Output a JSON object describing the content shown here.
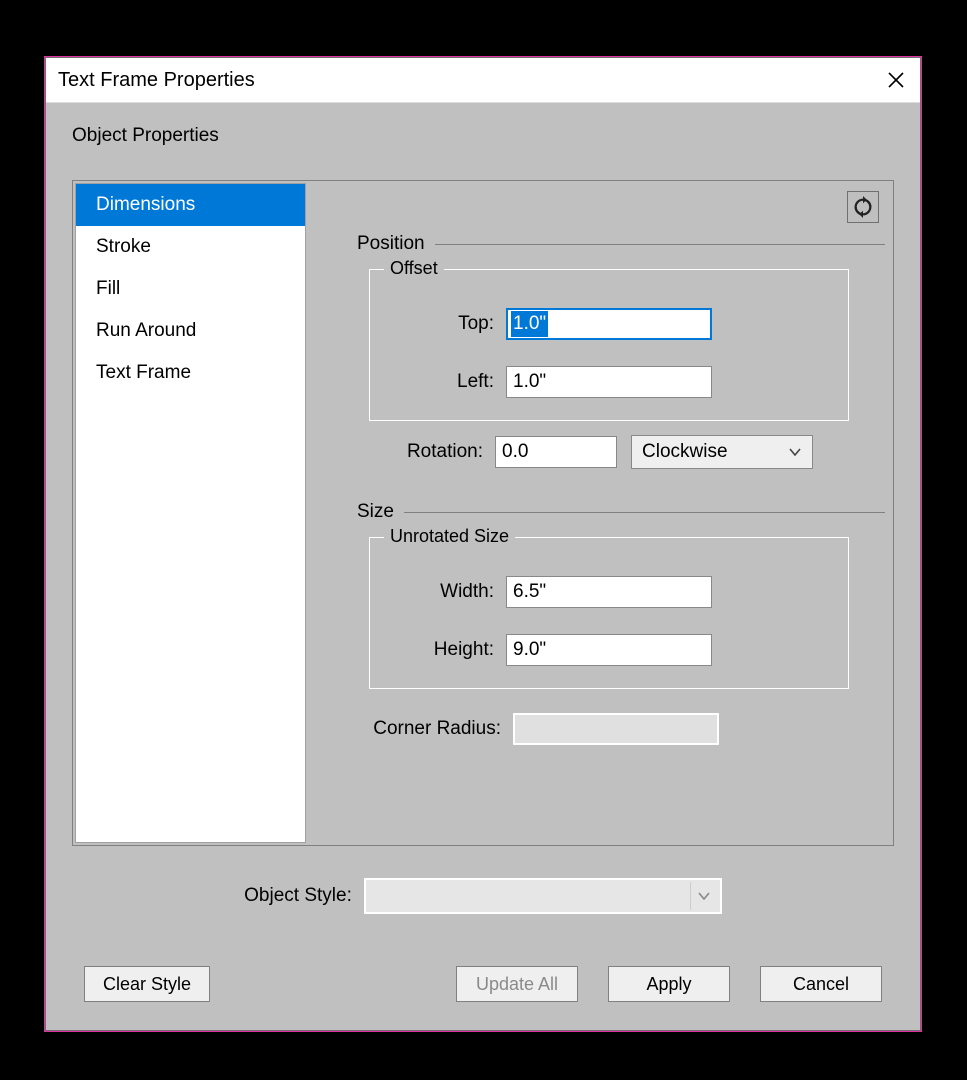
{
  "dialog": {
    "title": "Text Frame Properties",
    "subtitle": "Object Properties"
  },
  "sidebar": {
    "items": [
      {
        "label": "Dimensions",
        "selected": true
      },
      {
        "label": "Stroke",
        "selected": false
      },
      {
        "label": "Fill",
        "selected": false
      },
      {
        "label": "Run Around",
        "selected": false
      },
      {
        "label": "Text Frame",
        "selected": false
      }
    ]
  },
  "position": {
    "section_label": "Position",
    "offset_legend": "Offset",
    "top_label": "Top:",
    "top_value": "1.0\"",
    "left_label": "Left:",
    "left_value": "1.0\"",
    "rotation_label": "Rotation:",
    "rotation_value": "0.0",
    "rotation_direction": "Clockwise"
  },
  "size": {
    "section_label": "Size",
    "unrotated_legend": "Unrotated Size",
    "width_label": "Width:",
    "width_value": "6.5\"",
    "height_label": "Height:",
    "height_value": "9.0\"",
    "corner_radius_label": "Corner Radius:",
    "corner_radius_value": ""
  },
  "object_style": {
    "label": "Object Style:",
    "value": ""
  },
  "buttons": {
    "clear_style": "Clear Style",
    "update_all": "Update All",
    "apply": "Apply",
    "cancel": "Cancel"
  }
}
